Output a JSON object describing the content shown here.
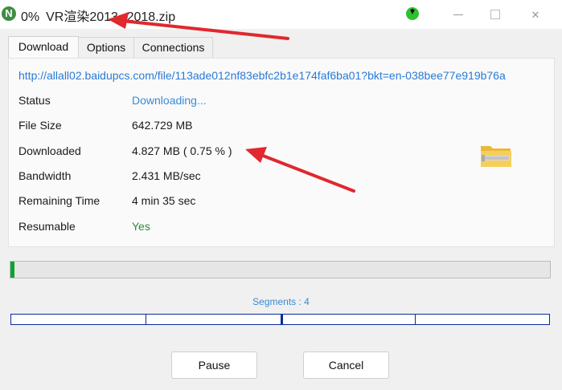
{
  "window": {
    "percent": "0%",
    "title": "VR渲染2013--2018.zip",
    "icon_letter": "N"
  },
  "tabs": [
    {
      "label": "Download",
      "active": true
    },
    {
      "label": "Options",
      "active": false
    },
    {
      "label": "Connections",
      "active": false
    }
  ],
  "download": {
    "url": "http://allall02.baidupcs.com/file/113ade012nf83ebfc2b1e174faf6ba01?bkt=en-038bee77e919b76a",
    "rows": [
      {
        "label": "Status",
        "value": "Downloading..."
      },
      {
        "label": "File Size",
        "value": "642.729  MB"
      },
      {
        "label": "Downloaded",
        "value": "4.827  MB  ( 0.75 % )"
      },
      {
        "label": "Bandwidth",
        "value": "2.431  MB/sec"
      },
      {
        "label": "Remaining Time",
        "value": "4 min  35 sec"
      },
      {
        "label": "Resumable",
        "value": "Yes"
      }
    ]
  },
  "progress": {
    "fraction": 0.0075
  },
  "segments": {
    "label": "Segments : 4",
    "count": 4
  },
  "buttons": {
    "pause": "Pause",
    "cancel": "Cancel"
  },
  "colors": {
    "accent": "#2a7ad6",
    "progress": "#0ca52c",
    "segment": "#0a2ba0",
    "arrow": "#e0282e",
    "yes": "#2d8a3e"
  },
  "icons": {
    "app": "idm-logo-icon",
    "download_status": "download-arrow-icon",
    "file": "zip-folder-icon"
  }
}
